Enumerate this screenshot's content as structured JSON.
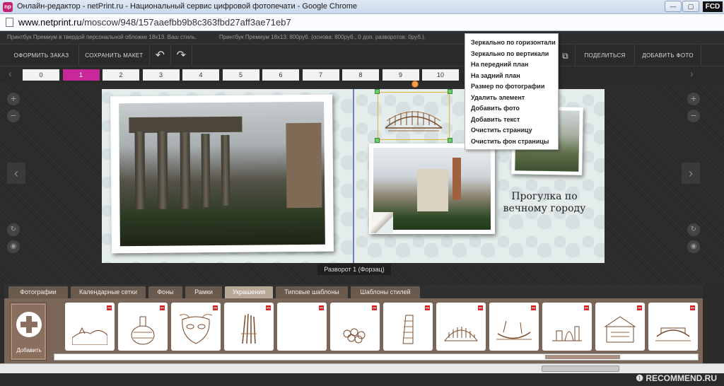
{
  "window": {
    "title": "Онлайн-редактор - netPrint.ru - Национальный сервис цифровой фотопечати - Google Chrome",
    "badge": "FCD"
  },
  "address": {
    "domain": "www.netprint.ru",
    "path": "/moscow/948/157aaefbb9b8c363fbd27aff3ae71eb7"
  },
  "info": {
    "left": "Принтбук Премиум в твердой персональной обложке 18х13. Ваш стиль.",
    "right": "Принтбук Премиум 18х13: 800руб. (основа: 800руб., 0 доп. разворотов: 0руб.)."
  },
  "toolbar": {
    "order": "ОФОРМИТЬ ЗАКАЗ",
    "save": "СОХРАНИТЬ МАКЕТ",
    "undo_icon": "↶",
    "redo_icon": "↷",
    "share": "ПОДЕЛИТЬСЯ",
    "add_photo": "ДОБАВИТЬ ФОТО"
  },
  "pages": [
    "0",
    "1",
    "2",
    "3",
    "4",
    "5",
    "6",
    "7",
    "8",
    "9",
    "10"
  ],
  "active_page": "1",
  "spread": {
    "caption": "Прогулка по вечному городу",
    "label": "Разворот 1 (Форзац)"
  },
  "context_menu": [
    "Зеркально по горизонтали",
    "Зеркально по вертикали",
    "На передний план",
    "На задний план",
    "Размер по фотографии",
    "Удалить элемент",
    "Добавить фото",
    "Добавить текст",
    "Очистить страницу",
    "Очистить фон страницы"
  ],
  "tabs": [
    "Фотографии",
    "Календарные сетки",
    "Фоны",
    "Рамки",
    "Украшения",
    "Типовые шаблоны",
    "Шаблоны стилей"
  ],
  "active_tab": "Украшения",
  "gallery": {
    "add_label": "Добавить",
    "items": [
      "landscape-sketch",
      "wine-bottle-sketch",
      "venetian-mask-sketch",
      "asparagus-sketch",
      "empty",
      "grapes-sketch",
      "pisa-tower-sketch",
      "colosseum-sketch",
      "gondola-sketch",
      "florence-sketch",
      "market-sketch",
      "bridge-sketch"
    ]
  },
  "watermark": "❶ RECOMMEND.RU",
  "colors": {
    "active_page": "#c8289a",
    "tab_bg": "#6a5a4e",
    "panel_bg": "#7a6658"
  }
}
